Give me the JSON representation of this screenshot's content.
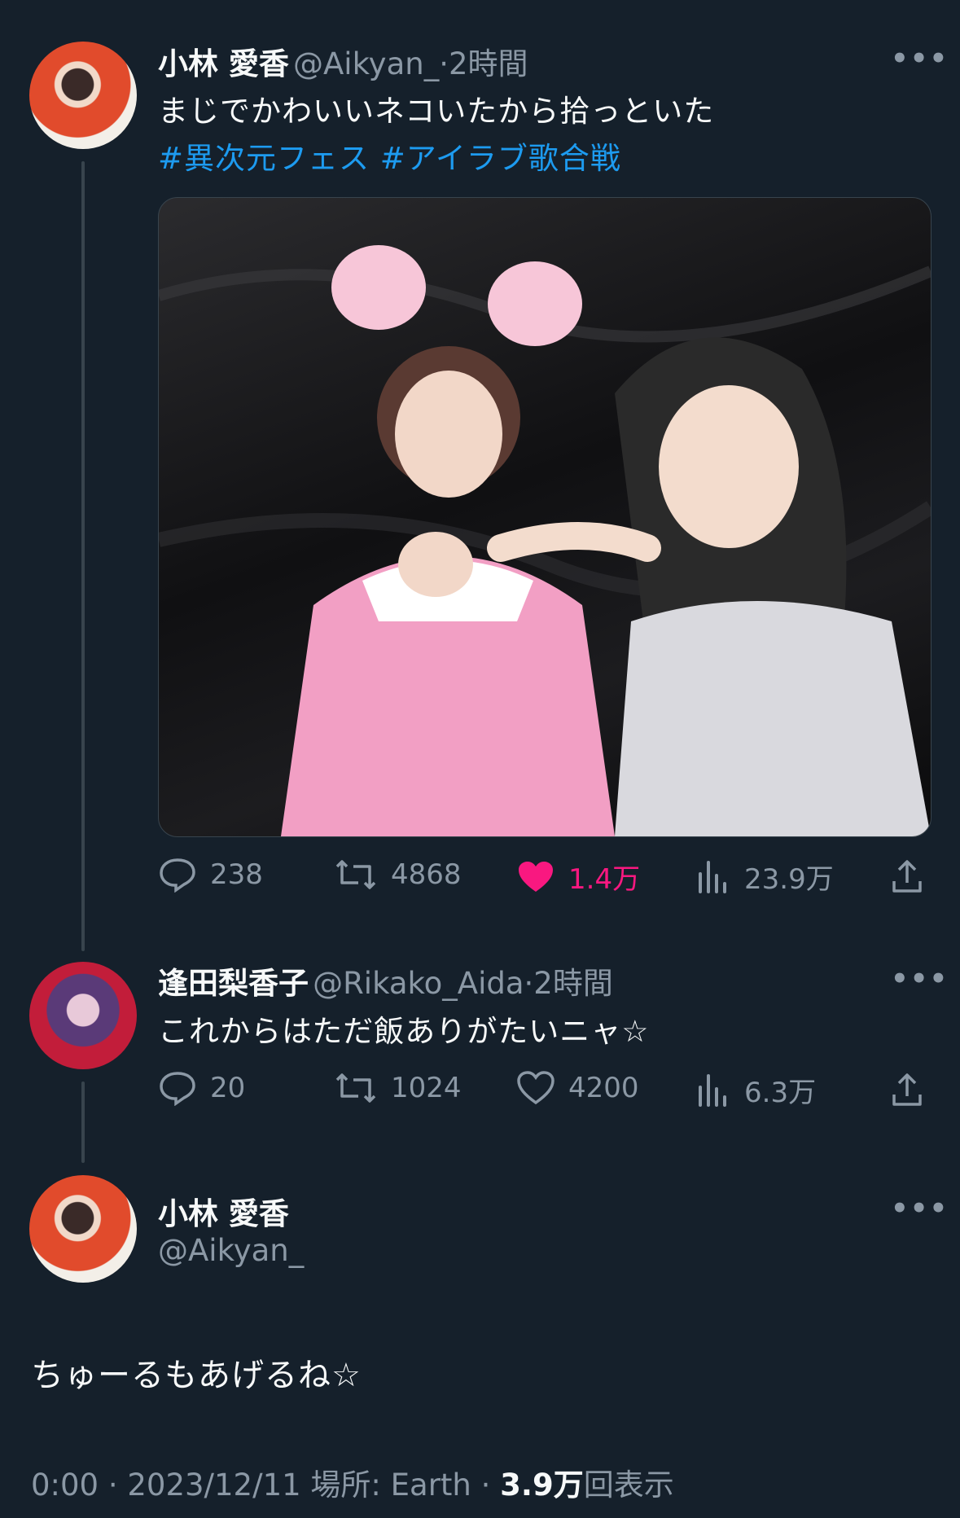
{
  "tweet1": {
    "name": "小林 愛香",
    "handle": "@Aikyan_",
    "time": "2時間",
    "text": "まじでかわいいネコいたから拾っといた",
    "hashtags": "#異次元フェス #アイラブ歌合戦",
    "replies": "238",
    "retweets": "4868",
    "likes": "1.4万",
    "views": "23.9万"
  },
  "tweet2": {
    "name": "逢田梨香子",
    "handle": "@Rikako_Aida",
    "time": "2時間",
    "text": "これからはただ飯ありがたいニャ☆",
    "replies": "20",
    "retweets": "1024",
    "likes": "4200",
    "views": "6.3万"
  },
  "tweet3": {
    "name": "小林 愛香",
    "handle": "@Aikyan_",
    "text": "ちゅーるもあげるね☆",
    "time": "0:00",
    "date": "2023/12/11",
    "location": "場所: Earth",
    "views_count": "3.9万",
    "views_suffix": "回表示"
  },
  "separator": "·",
  "more_glyph": "•••",
  "colors": {
    "background": "#15202b",
    "accent": "#1d9bf0",
    "like": "#f91880",
    "muted": "#8b98a5"
  }
}
